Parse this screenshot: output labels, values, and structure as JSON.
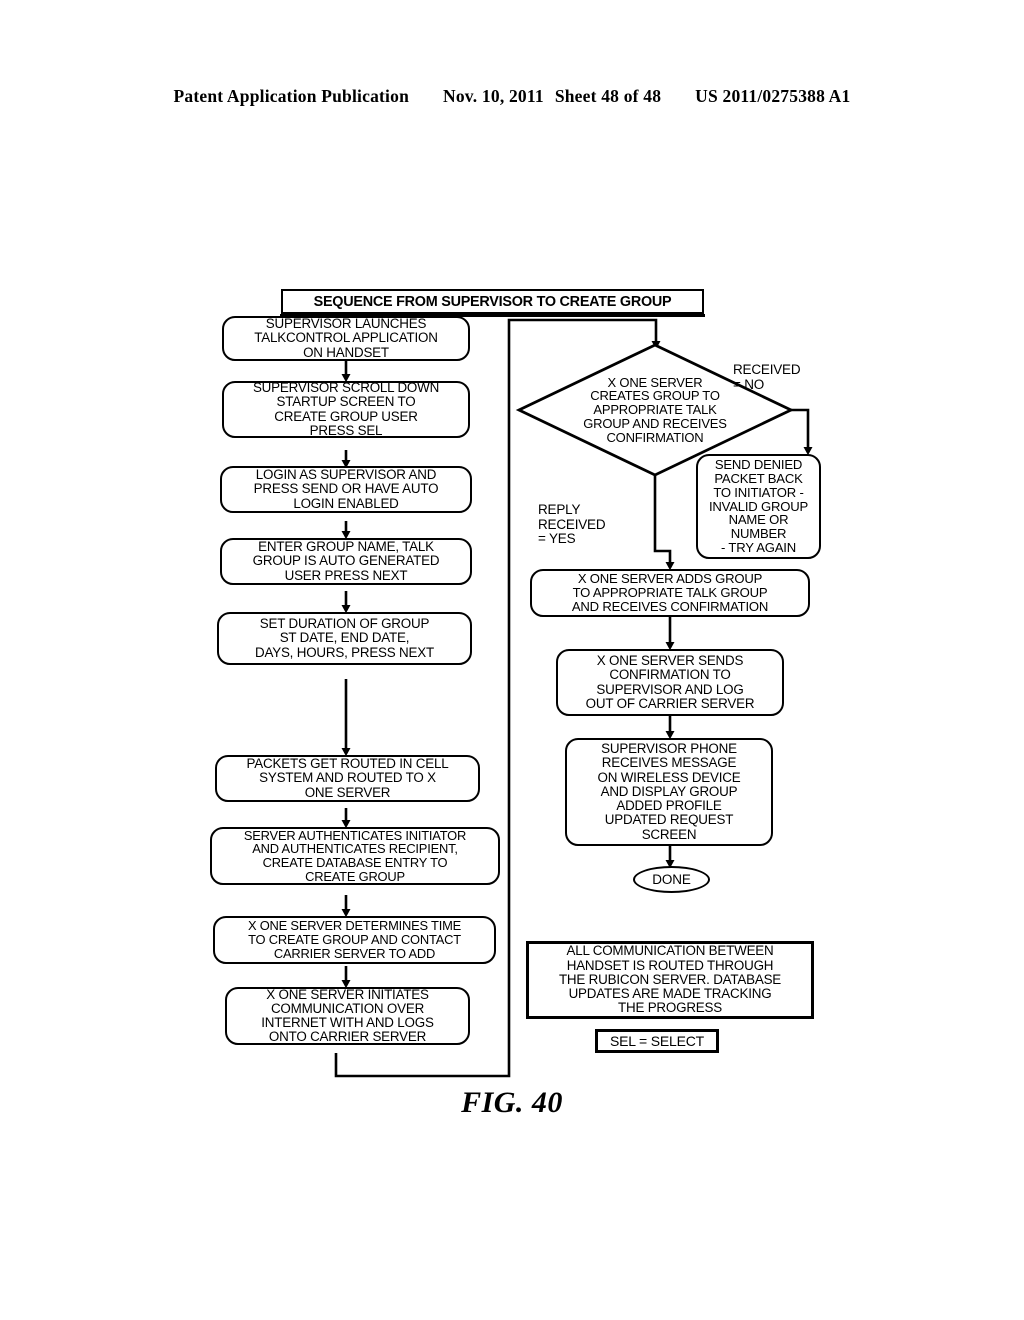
{
  "page_header": {
    "publication": "Patent Application Publication",
    "date": "Nov. 10, 2011",
    "sheet": "Sheet 48 of 48",
    "patent_number": "US 2011/0275388 A1"
  },
  "figure": {
    "caption": "FIG. 40",
    "title_banner": "SEQUENCE FROM SUPERVISOR TO CREATE GROUP"
  },
  "left_column": {
    "step1": "SUPERVISOR LAUNCHES\nTALKCONTROL APPLICATION\nON HANDSET",
    "step2": "SUPERVISOR SCROLL DOWN\nSTARTUP SCREEN TO\nCREATE GROUP USER\nPRESS SEL",
    "step3": "LOGIN AS SUPERVISOR AND\nPRESS SEND OR HAVE AUTO\nLOGIN ENABLED",
    "step4": "ENTER GROUP NAME, TALK\nGROUP IS AUTO GENERATED\nUSER PRESS NEXT",
    "step5": "SET DURATION OF GROUP\nST DATE, END DATE,\nDAYS, HOURS, PRESS NEXT",
    "step6": "PACKETS GET ROUTED IN CELL\nSYSTEM AND ROUTED TO X\nONE SERVER",
    "step7": "SERVER AUTHENTICATES INITIATOR\nAND AUTHENTICATES RECIPIENT,\nCREATE DATABASE ENTRY TO\nCREATE GROUP",
    "step8": "X ONE SERVER DETERMINES TIME\nTO CREATE GROUP AND CONTACT\nCARRIER SERVER TO ADD",
    "step9": "X ONE SERVER INITIATES\nCOMMUNICATION OVER\nINTERNET WITH AND LOGS\nONTO CARRIER SERVER"
  },
  "right_column": {
    "decision": "X ONE SERVER\nCREATES GROUP TO\nAPPROPRIATE TALK\nGROUP AND RECEIVES\nCONFIRMATION",
    "label_no": "RECEIVED\n= NO",
    "label_yes": "REPLY\nRECEIVED\n= YES",
    "denied_box": "SEND DENIED\nPACKET BACK\nTO INITIATOR -\nINVALID GROUP\nNAME OR\nNUMBER\n- TRY AGAIN",
    "adds_group": "X ONE SERVER ADDS GROUP\nTO APPROPRIATE TALK GROUP\nAND RECEIVES CONFIRMATION",
    "sends_confirmation": "X ONE SERVER SENDS\nCONFIRMATION TO\nSUPERVISOR AND LOG\nOUT OF CARRIER SERVER",
    "supervisor_phone": "SUPERVISOR PHONE\nRECEIVES MESSAGE\nON WIRELESS DEVICE\nAND DISPLAY GROUP\nADDED PROFILE\nUPDATED REQUEST\nSCREEN",
    "done": "DONE"
  },
  "notes": {
    "communication_note": "ALL COMMUNICATION BETWEEN\nHANDSET IS ROUTED THROUGH\nTHE RUBICON SERVER.  DATABASE\nUPDATES ARE MADE TRACKING\nTHE PROGRESS",
    "legend": "SEL = SELECT"
  },
  "colors": {
    "ink": "#000000",
    "paper": "#ffffff"
  }
}
